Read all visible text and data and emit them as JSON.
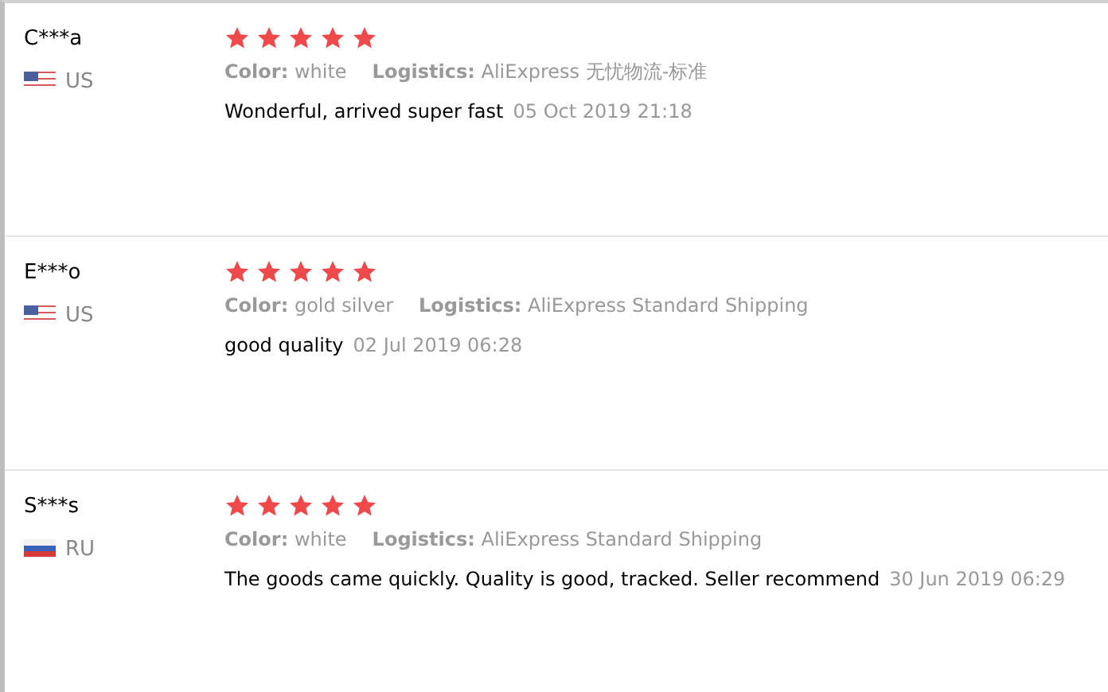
{
  "reviews": [
    {
      "name": "C***a",
      "kind": "us",
      "country": "US",
      "stars": 5,
      "color_label": "Color:",
      "product_color": "white",
      "logistics_label": "Logistics:",
      "logistics": "AliExpress 无忧物流-标准",
      "text": "Wonderful, arrived super fast",
      "date": "05 Oct 2019 21:18"
    },
    {
      "name": "E***o",
      "kind": "us",
      "country": "US",
      "stars": 5,
      "color_label": "Color:",
      "product_color": "gold silver",
      "logistics_label": "Logistics:",
      "logistics": "AliExpress Standard Shipping",
      "text": "good quality",
      "date": "02 Jul 2019 06:28"
    },
    {
      "name": "S***s",
      "kind": "ru",
      "country": "RU",
      "stars": 5,
      "color_label": "Color:",
      "product_color": "white",
      "logistics_label": "Logistics:",
      "logistics": "AliExpress Standard Shipping",
      "text": "The goods came quickly. Quality is good, tracked. Seller recommend",
      "date": "30 Jun 2019 06:29"
    }
  ]
}
